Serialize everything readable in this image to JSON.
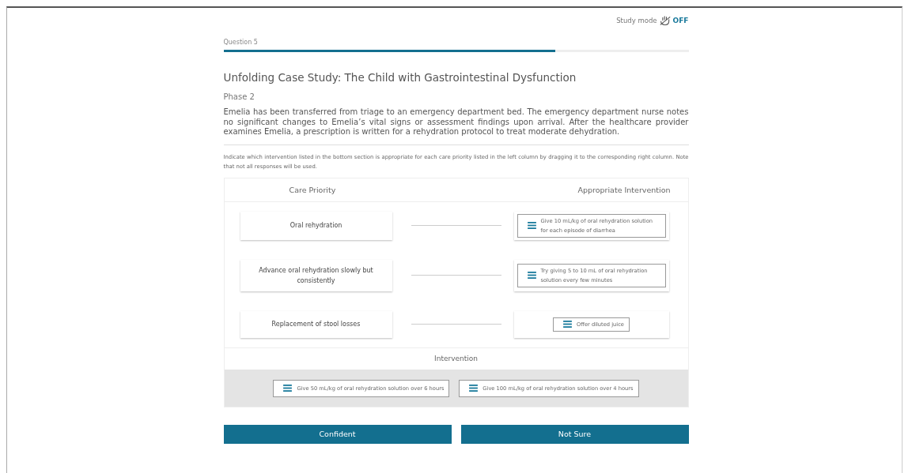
{
  "study_mode": {
    "label": "Study mode",
    "value": "OFF"
  },
  "question": {
    "label": "Question 5",
    "progress": {
      "level": 0.714
    }
  },
  "title": "Unfolding Case Study: The Child with Gastrointestinal Dysfunction",
  "phase": "Phase 2",
  "scenario": "Emelia has been transferred from triage to an emergency department bed. The emergency department nurse notes no significant changes to Emelia’s vital signs or assessment findings upon arrival. After the healthcare provider examines Emelia, a prescription is written for a rehydration protocol to treat moderate dehydration.",
  "instructions": "Indicate which intervention listed in the bottom section is appropriate for each care priority listed in the left column by dragging it to the corresponding right column. Note that not all responses will be used.",
  "matching": {
    "columns": [
      "Care Priority",
      "Appropriate Intervention"
    ],
    "rows": [
      {
        "priority": "Oral rehydration",
        "answer": "Give 10 mL/kg of oral rehydration solution for each episode of diarrhea"
      },
      {
        "priority": "Advance oral rehydration slowly but consistently",
        "answer": "Try giving 5 to 10 mL of oral rehydration solution every few minutes"
      },
      {
        "priority": "Replacement of stool losses",
        "answer": "Offer diluted juice"
      }
    ],
    "pool_title": "Intervention",
    "pool": [
      "Give 50 mL/kg of oral rehydration solution over 6 hours",
      "Give 100 mL/kg of oral rehydration solution over 4 hours"
    ]
  },
  "buttons": [
    "Confident",
    "Not Sure"
  ]
}
